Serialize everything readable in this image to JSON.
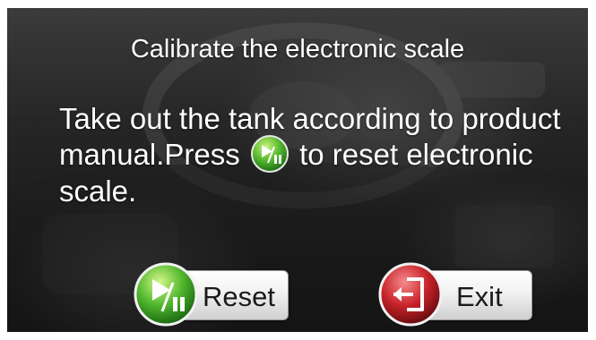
{
  "dialog": {
    "title": "Calibrate the electronic scale",
    "message_part1": "Take out the tank according to product manual.Press",
    "message_part2": "to reset electronic scale."
  },
  "buttons": {
    "reset_label": "Reset",
    "exit_label": "Exit"
  },
  "icons": {
    "inline": "play-pause-icon",
    "reset": "play-pause-icon",
    "exit": "exit-door-icon"
  },
  "colors": {
    "green_icon": "#3fa92b",
    "red_icon": "#c8232a",
    "text": "#ffffff",
    "button_text": "#1a1a1a"
  }
}
